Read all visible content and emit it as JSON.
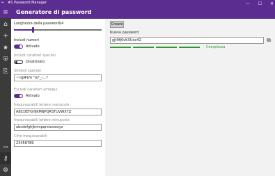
{
  "window": {
    "title": "#1 Password Manager",
    "controls": [
      "—",
      "☐",
      "✕"
    ]
  },
  "header": {
    "title": "Generatore di password"
  },
  "sidebar": {
    "items": [
      {
        "icon": "home-icon",
        "glyph": "⌂"
      },
      {
        "icon": "add-icon",
        "glyph": "+"
      },
      {
        "icon": "star-icon",
        "glyph": "★"
      },
      {
        "icon": "shield-icon",
        "glyph": "⛨"
      },
      {
        "icon": "import-icon",
        "glyph": "⎘"
      }
    ],
    "bottom": [
      {
        "icon": "clipboard-icon",
        "glyph": "📋"
      },
      {
        "icon": "key-icon",
        "glyph": "🔑"
      },
      {
        "icon": "settings-icon",
        "glyph": "⚙"
      }
    ]
  },
  "generator": {
    "length_label": "Lunghezza della password:",
    "length_value": "14",
    "length_fraction": 0.22,
    "numbers_label": "Includi numeri",
    "numbers_state": "Attivato",
    "special_label": "Includi caratteri speciali",
    "special_state": "Disattivato",
    "special_symbols_label": "Simboli speciali",
    "special_symbols_value": "~!@#$%^&*_-;,.?",
    "ambiguous_label": "Escludi caratteri ambigui",
    "ambiguous_state": "Attivato",
    "upper_label": "Inequivocabili lettere maiuscole",
    "upper_value": "ABCDEFGHJKMNPQRSTUVWXYZ",
    "lower_label": "Inequivocabili lettere minuscole",
    "lower_value": "abcdefghjkmnpqrstuvwxyz",
    "digits_label": "Cifre inequivocabili",
    "digits_value": "23456789"
  },
  "result": {
    "create_button": "Creare",
    "new_password_label": "Nuova password",
    "password": "gJt9fJ6vKXUce42",
    "strength_label": "Complessa",
    "strength_color": "#2e9a2e",
    "accent_color": "#5c2d91"
  }
}
